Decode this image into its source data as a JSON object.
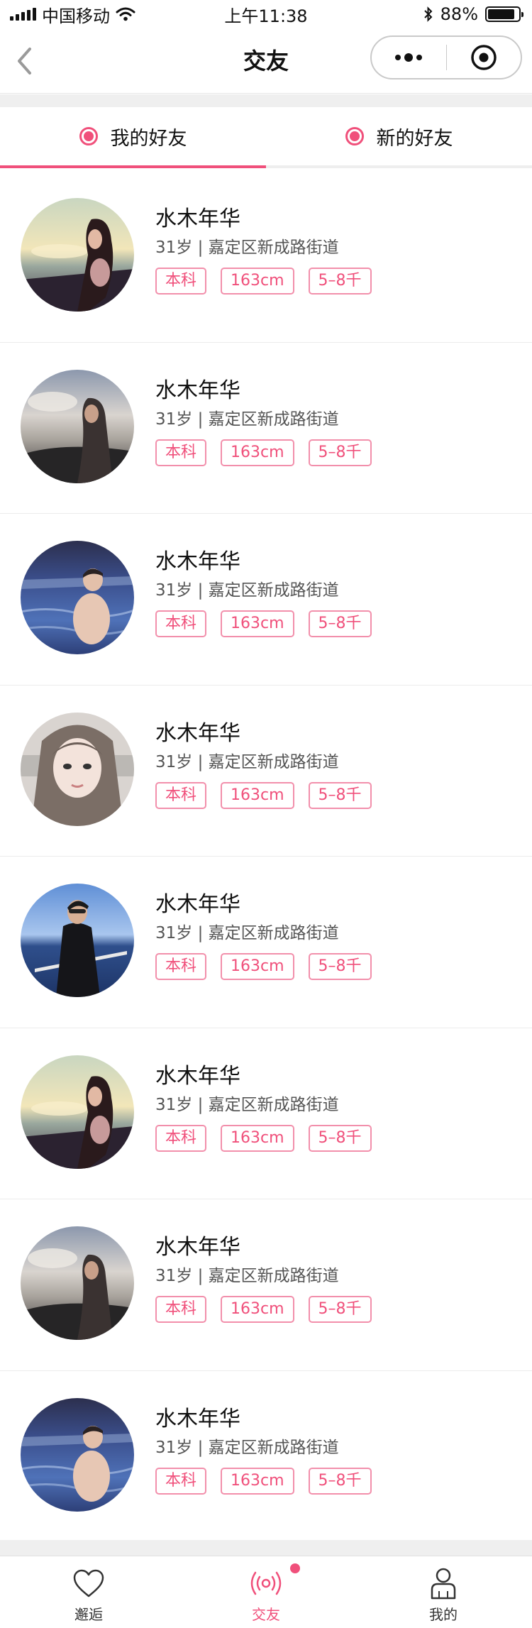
{
  "status_bar": {
    "carrier": "中国移动",
    "time": "上午11:38",
    "battery": "88%",
    "battery_level": 0.88
  },
  "nav": {
    "title": "交友"
  },
  "tabs": [
    {
      "label": "我的好友",
      "active": true
    },
    {
      "label": "新的好友",
      "active": false
    }
  ],
  "friends": [
    {
      "name": "水木年华",
      "meta": "31岁 | 嘉定区新成路街道",
      "tags": [
        "本科",
        "163cm",
        "5–8千"
      ],
      "avatar": "avatar-woman-sunset"
    },
    {
      "name": "水木年华",
      "meta": "31岁 | 嘉定区新成路街道",
      "tags": [
        "本科",
        "163cm",
        "5–8千"
      ],
      "avatar": "avatar-woman-cloudy"
    },
    {
      "name": "水木年华",
      "meta": "31岁 | 嘉定区新成路街道",
      "tags": [
        "本科",
        "163cm",
        "5–8千"
      ],
      "avatar": "avatar-man-pool"
    },
    {
      "name": "水木年华",
      "meta": "31岁 | 嘉定区新成路街道",
      "tags": [
        "本科",
        "163cm",
        "5–8千"
      ],
      "avatar": "avatar-woman-portrait"
    },
    {
      "name": "水木年华",
      "meta": "31岁 | 嘉定区新成路街道",
      "tags": [
        "本科",
        "163cm",
        "5–8千"
      ],
      "avatar": "avatar-man-sea"
    },
    {
      "name": "水木年华",
      "meta": "31岁 | 嘉定区新成路街道",
      "tags": [
        "本科",
        "163cm",
        "5–8千"
      ],
      "avatar": "avatar-woman-sunset"
    },
    {
      "name": "水木年华",
      "meta": "31岁 | 嘉定区新成路街道",
      "tags": [
        "本科",
        "163cm",
        "5–8千"
      ],
      "avatar": "avatar-woman-cloudy"
    },
    {
      "name": "水木年华",
      "meta": "31岁 | 嘉定区新成路街道",
      "tags": [
        "本科",
        "163cm",
        "5–8千"
      ],
      "avatar": "avatar-man-pool"
    }
  ],
  "tab_bar": [
    {
      "label": "邂逅",
      "icon": "heart-icon",
      "active": false
    },
    {
      "label": "交友",
      "icon": "broadcast-icon",
      "active": true,
      "badge": true
    },
    {
      "label": "我的",
      "icon": "person-icon",
      "active": false
    }
  ],
  "colors": {
    "accent": "#f0507b",
    "tag_border": "#f28fab"
  }
}
